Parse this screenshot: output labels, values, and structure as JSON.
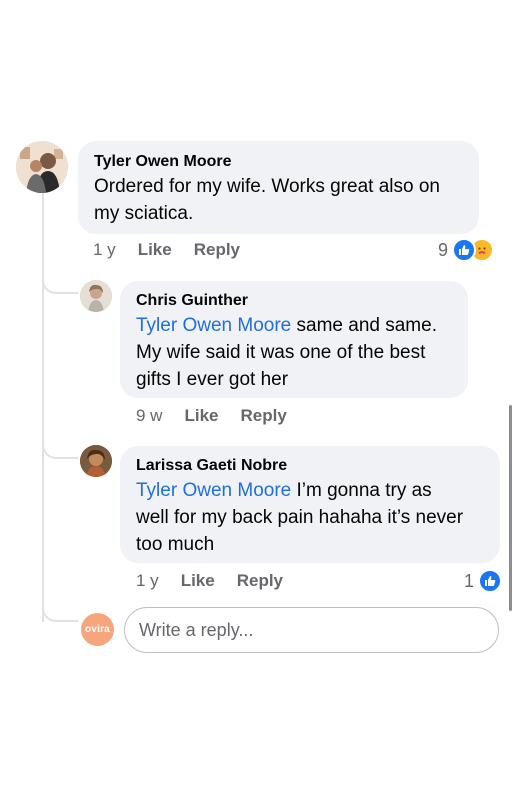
{
  "colors": {
    "bubble": "#f0f2f5",
    "mention": "#216fdb",
    "meta": "#65676b",
    "like_blue": "#1877f2",
    "reply_avatar": "#f6a57c"
  },
  "comments": [
    {
      "author": "Tyler Owen Moore",
      "text": "Ordered for my wife. Works great also on my sciatica.",
      "time": "1 y",
      "like_label": "Like",
      "reply_label": "Reply",
      "reaction_count": "9",
      "reaction_icons": [
        "like-icon",
        "care-icon"
      ]
    }
  ],
  "replies": [
    {
      "author": "Chris Guinther",
      "mention": "Tyler Owen Moore",
      "text_line1": " same and same.",
      "text_line2": "My wife said it was one of the best",
      "text_line3": "gifts I ever got her",
      "time": "9 w",
      "like_label": "Like",
      "reply_label": "Reply"
    },
    {
      "author": "Larissa Gaeti Nobre",
      "mention": "Tyler Owen Moore",
      "text_line1": " I’m gonna try as",
      "text_line2": "well for my back pain hahaha it’s never",
      "text_line3": "too much",
      "time": "1 y",
      "like_label": "Like",
      "reply_label": "Reply",
      "reaction_count": "1",
      "reaction_icons": [
        "like-icon"
      ]
    }
  ],
  "composer": {
    "avatar_text": "ovira",
    "placeholder": "Write a reply..."
  }
}
